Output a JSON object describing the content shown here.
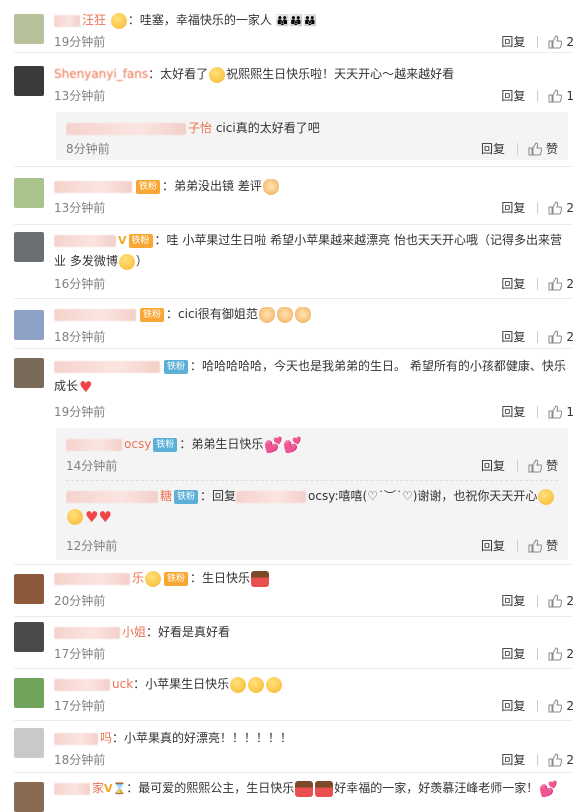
{
  "comments": [
    {
      "name": "汪狂",
      "message": "：哇塞，幸福快乐的一家人",
      "time": "19分钟前",
      "reply": "回复",
      "likes": "2",
      "avatar_color": "#b7c29b"
    },
    {
      "name": "Shenyanyi_fans",
      "message": "：太好看了",
      "message2": "祝熙熙生日快乐啦！天天开心～越来越好看",
      "time": "13分钟前",
      "reply": "回复",
      "likes": "1",
      "avatar_color": "#3a3a3a"
    },
    {
      "name": "子怡",
      "message": " cici真的太好看了吧",
      "time": "8分钟前",
      "reply": "回复",
      "likes": "赞",
      "avatar_color": ""
    },
    {
      "name": "",
      "badge": "铁粉",
      "message": "：弟弟没出镜 差评",
      "time": "13分钟前",
      "reply": "回复",
      "likes": "2",
      "avatar_color": "#a9c48a"
    },
    {
      "name": "",
      "badge": "铁粉",
      "message": "：哇 小苹果过生日啦 希望小苹果越来越漂亮 怡也天天开心哦（记得多出来营业 多发微博",
      "message2": "）",
      "time": "16分钟前",
      "reply": "回复",
      "likes": "2",
      "avatar_color": "#6b6e73"
    },
    {
      "name": "",
      "badge": "铁粉",
      "message": "：cici很有御姐范",
      "time": "18分钟前",
      "reply": "回复",
      "likes": "2",
      "avatar_color": "#8da1c6"
    },
    {
      "name": "",
      "badge": "铁粉",
      "message": "：哈哈哈哈哈，今天也是我弟弟的生日。 希望所有的小孩都健康、快乐成长",
      "time": "19分钟前",
      "reply": "回复",
      "likes": "1",
      "avatar_color": "#7a6a5a"
    },
    {
      "name": "ocsy",
      "badge": "铁粉",
      "message": "：弟弟生日快乐",
      "time": "14分钟前",
      "reply": "回复",
      "likes": "赞",
      "avatar_color": ""
    },
    {
      "name": "糖",
      "badge": "铁粉",
      "message": "：回复",
      "message2": "ocsy:嘻嘻(♡˙︶˙♡)谢谢，也祝你天天开心",
      "time": "12分钟前",
      "reply": "回复",
      "likes": "赞",
      "avatar_color": ""
    },
    {
      "name": "乐",
      "badge": "铁粉",
      "message": "：生日快乐",
      "time": "20分钟前",
      "reply": "回复",
      "likes": "2",
      "avatar_color": "#8c5a3a"
    },
    {
      "name": "小姐",
      "message": "：好看是真好看",
      "time": "17分钟前",
      "reply": "回复",
      "likes": "2",
      "avatar_color": "#4a4a4a"
    },
    {
      "name": "uck",
      "message": "：小苹果生日快乐",
      "time": "17分钟前",
      "reply": "回复",
      "likes": "2",
      "avatar_color": "#6fa35c"
    },
    {
      "name": "吗",
      "message": "：小苹果真的好漂亮！！！！！！",
      "time": "18分钟前",
      "reply": "回复",
      "likes": "2",
      "avatar_color": "#c9c9c9"
    },
    {
      "name": "家",
      "message": "：最可爱的熙熙公主，生日快乐",
      "message2": "好幸福的一家，好羡慕汪峰老师一家！",
      "time": "",
      "reply": "",
      "likes": "",
      "avatar_color": "#8a6a50"
    }
  ],
  "icons": {
    "like": "thumb-up-icon",
    "reply": "reply-link"
  },
  "colors": {
    "username": "#eb7350",
    "time": "#808080",
    "sub_bg": "#f4f4f4",
    "badge_teal": "#5ab0d6",
    "badge_orange": "#f9a733"
  }
}
